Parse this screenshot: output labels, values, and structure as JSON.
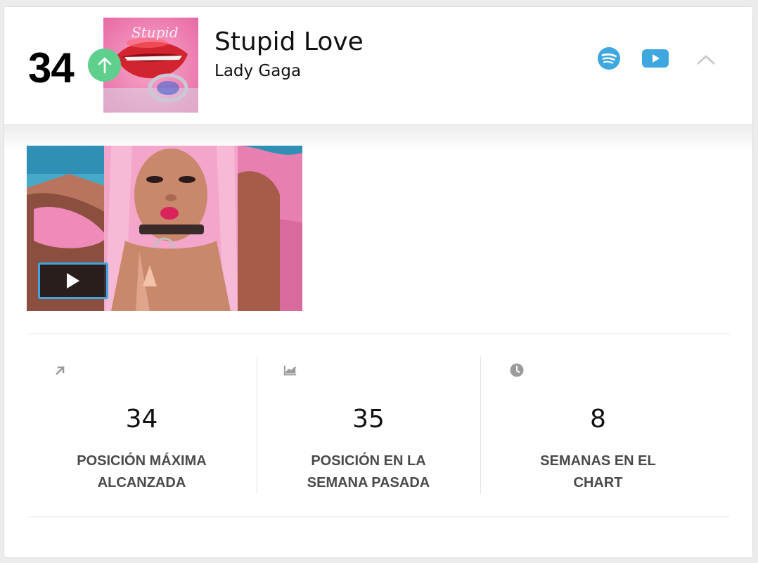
{
  "entry": {
    "rank": "34",
    "trend": "up",
    "title": "Stupid Love",
    "artist": "Lady Gaga"
  },
  "actions": {
    "spotify_icon": "spotify-icon",
    "youtube_icon": "youtube-play-icon",
    "collapse_icon": "chevron-up-icon"
  },
  "video": {
    "play_icon": "play-icon"
  },
  "stats": [
    {
      "icon": "arrow-up-right-icon",
      "value": "34",
      "label": "POSICIÓN MÁXIMA ALCANZADA"
    },
    {
      "icon": "line-chart-icon",
      "value": "35",
      "label": "POSICIÓN EN LA SEMANA PASADA"
    },
    {
      "icon": "clock-icon",
      "value": "8",
      "label": "SEMANAS EN EL CHART"
    }
  ],
  "colors": {
    "trend_up": "#5fcf8e",
    "brand_blue": "#3fa7e0",
    "icon_gray": "#9b9b9b",
    "label_gray": "#4a4a4a"
  }
}
